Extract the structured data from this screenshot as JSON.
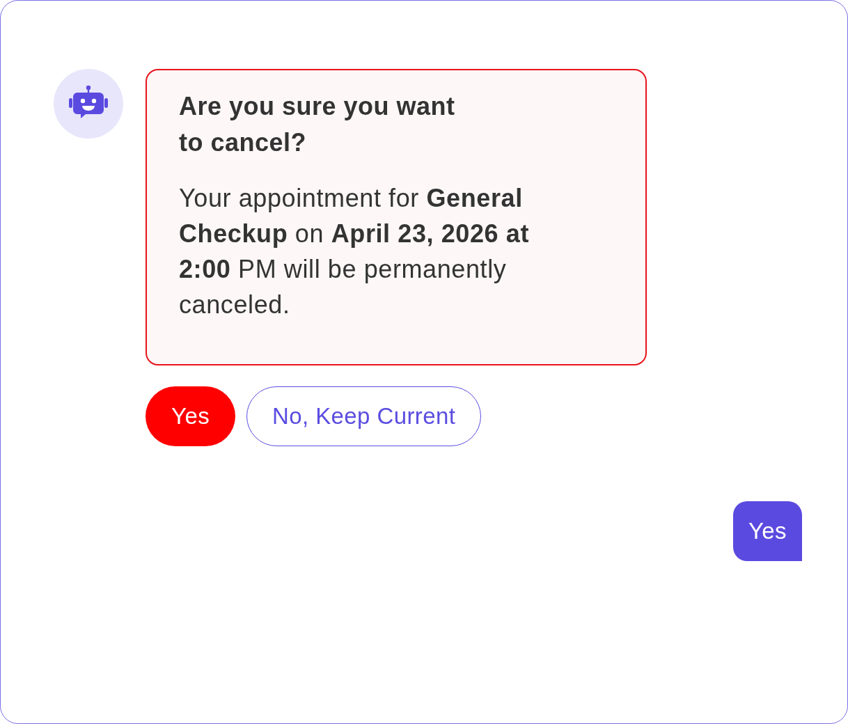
{
  "bot_message": {
    "title": "Are you sure you want to cancel?",
    "body": "Your appointment for **General Checkup** on **April 23, 2026 at 2:00** PM will be permanently canceled."
  },
  "quick_replies": [
    {
      "label": "Yes",
      "kind": "danger"
    },
    {
      "label": "No, Keep Current",
      "kind": "outline"
    }
  ],
  "user_message": {
    "text": "Yes"
  }
}
